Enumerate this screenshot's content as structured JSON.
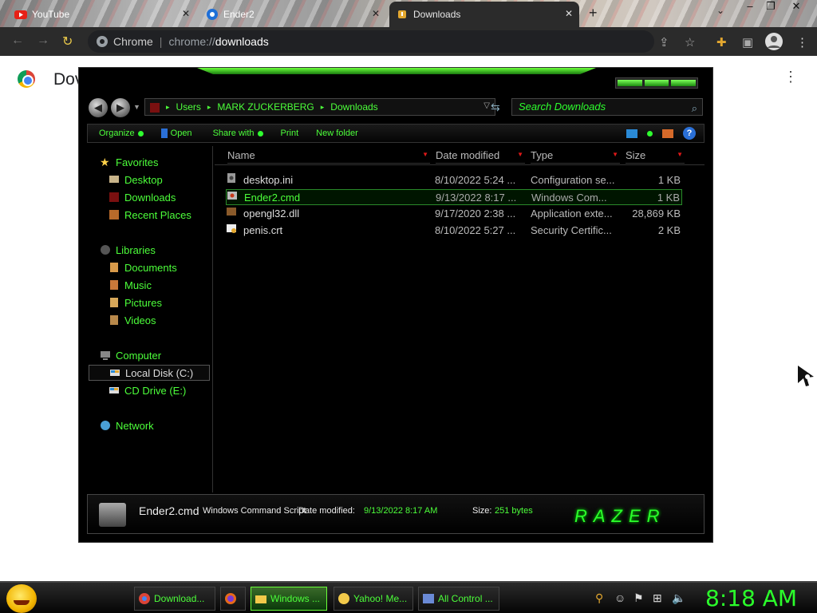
{
  "browser": {
    "tabs": [
      {
        "label": "YouTube",
        "active": false
      },
      {
        "label": "Ender2",
        "active": false
      },
      {
        "label": "Downloads",
        "active": true
      }
    ],
    "new_tab": "+",
    "window_controls": [
      "–",
      "❐",
      "✕"
    ],
    "omnibox": {
      "site_chip": "Chrome",
      "url_scheme": "chrome://",
      "url_host": "downloads"
    }
  },
  "page": {
    "title": "Dov",
    "menu_icon": "⋮"
  },
  "explorer": {
    "breadcrumb": [
      "Users",
      "MARK ZUCKERBERG",
      "Downloads"
    ],
    "search_placeholder": "Search Downloads",
    "commands": [
      "Organize",
      "Open",
      "Share with",
      "Print",
      "New folder"
    ],
    "nav": {
      "favorites": "Favorites",
      "favorites_items": [
        "Desktop",
        "Downloads",
        "Recent Places"
      ],
      "libraries": "Libraries",
      "libraries_items": [
        "Documents",
        "Music",
        "Pictures",
        "Videos"
      ],
      "computer": "Computer",
      "computer_items": [
        "Local Disk (C:)",
        "CD Drive (E:)"
      ],
      "network": "Network"
    },
    "columns": [
      "Name",
      "Date modified",
      "Type",
      "Size"
    ],
    "files": [
      {
        "name": "desktop.ini",
        "date": "8/10/2022 5:24 ...",
        "type": "Configuration se...",
        "size": "1 KB",
        "selected": false
      },
      {
        "name": "Ender2.cmd",
        "date": "9/13/2022 8:17 ...",
        "type": "Windows Com...",
        "size": "1 KB",
        "selected": true
      },
      {
        "name": "opengl32.dll",
        "date": "9/17/2020 2:38 ...",
        "type": "Application exte...",
        "size": "28,869 KB",
        "selected": false
      },
      {
        "name": "penis.crt",
        "date": "8/10/2022 5:27 ...",
        "type": "Security Certific...",
        "size": "2 KB",
        "selected": false
      }
    ],
    "details": {
      "name": "Ender2.cmd",
      "type": "Windows Command Script",
      "date_label": "Date modified:",
      "date": "9/13/2022 8:17 AM",
      "size_label": "Size:",
      "size": "251 bytes",
      "brand": "RAZER"
    }
  },
  "taskbar": {
    "items": [
      {
        "label": "Download...",
        "active": false
      },
      {
        "label": "",
        "active": false
      },
      {
        "label": "Windows ...",
        "active": true
      },
      {
        "label": "Yahoo! Me...",
        "active": false
      },
      {
        "label": "All Control ...",
        "active": false
      }
    ],
    "clock": "8:18 AM"
  },
  "colors": {
    "accent": "#4cff3a",
    "background": "#000000"
  }
}
